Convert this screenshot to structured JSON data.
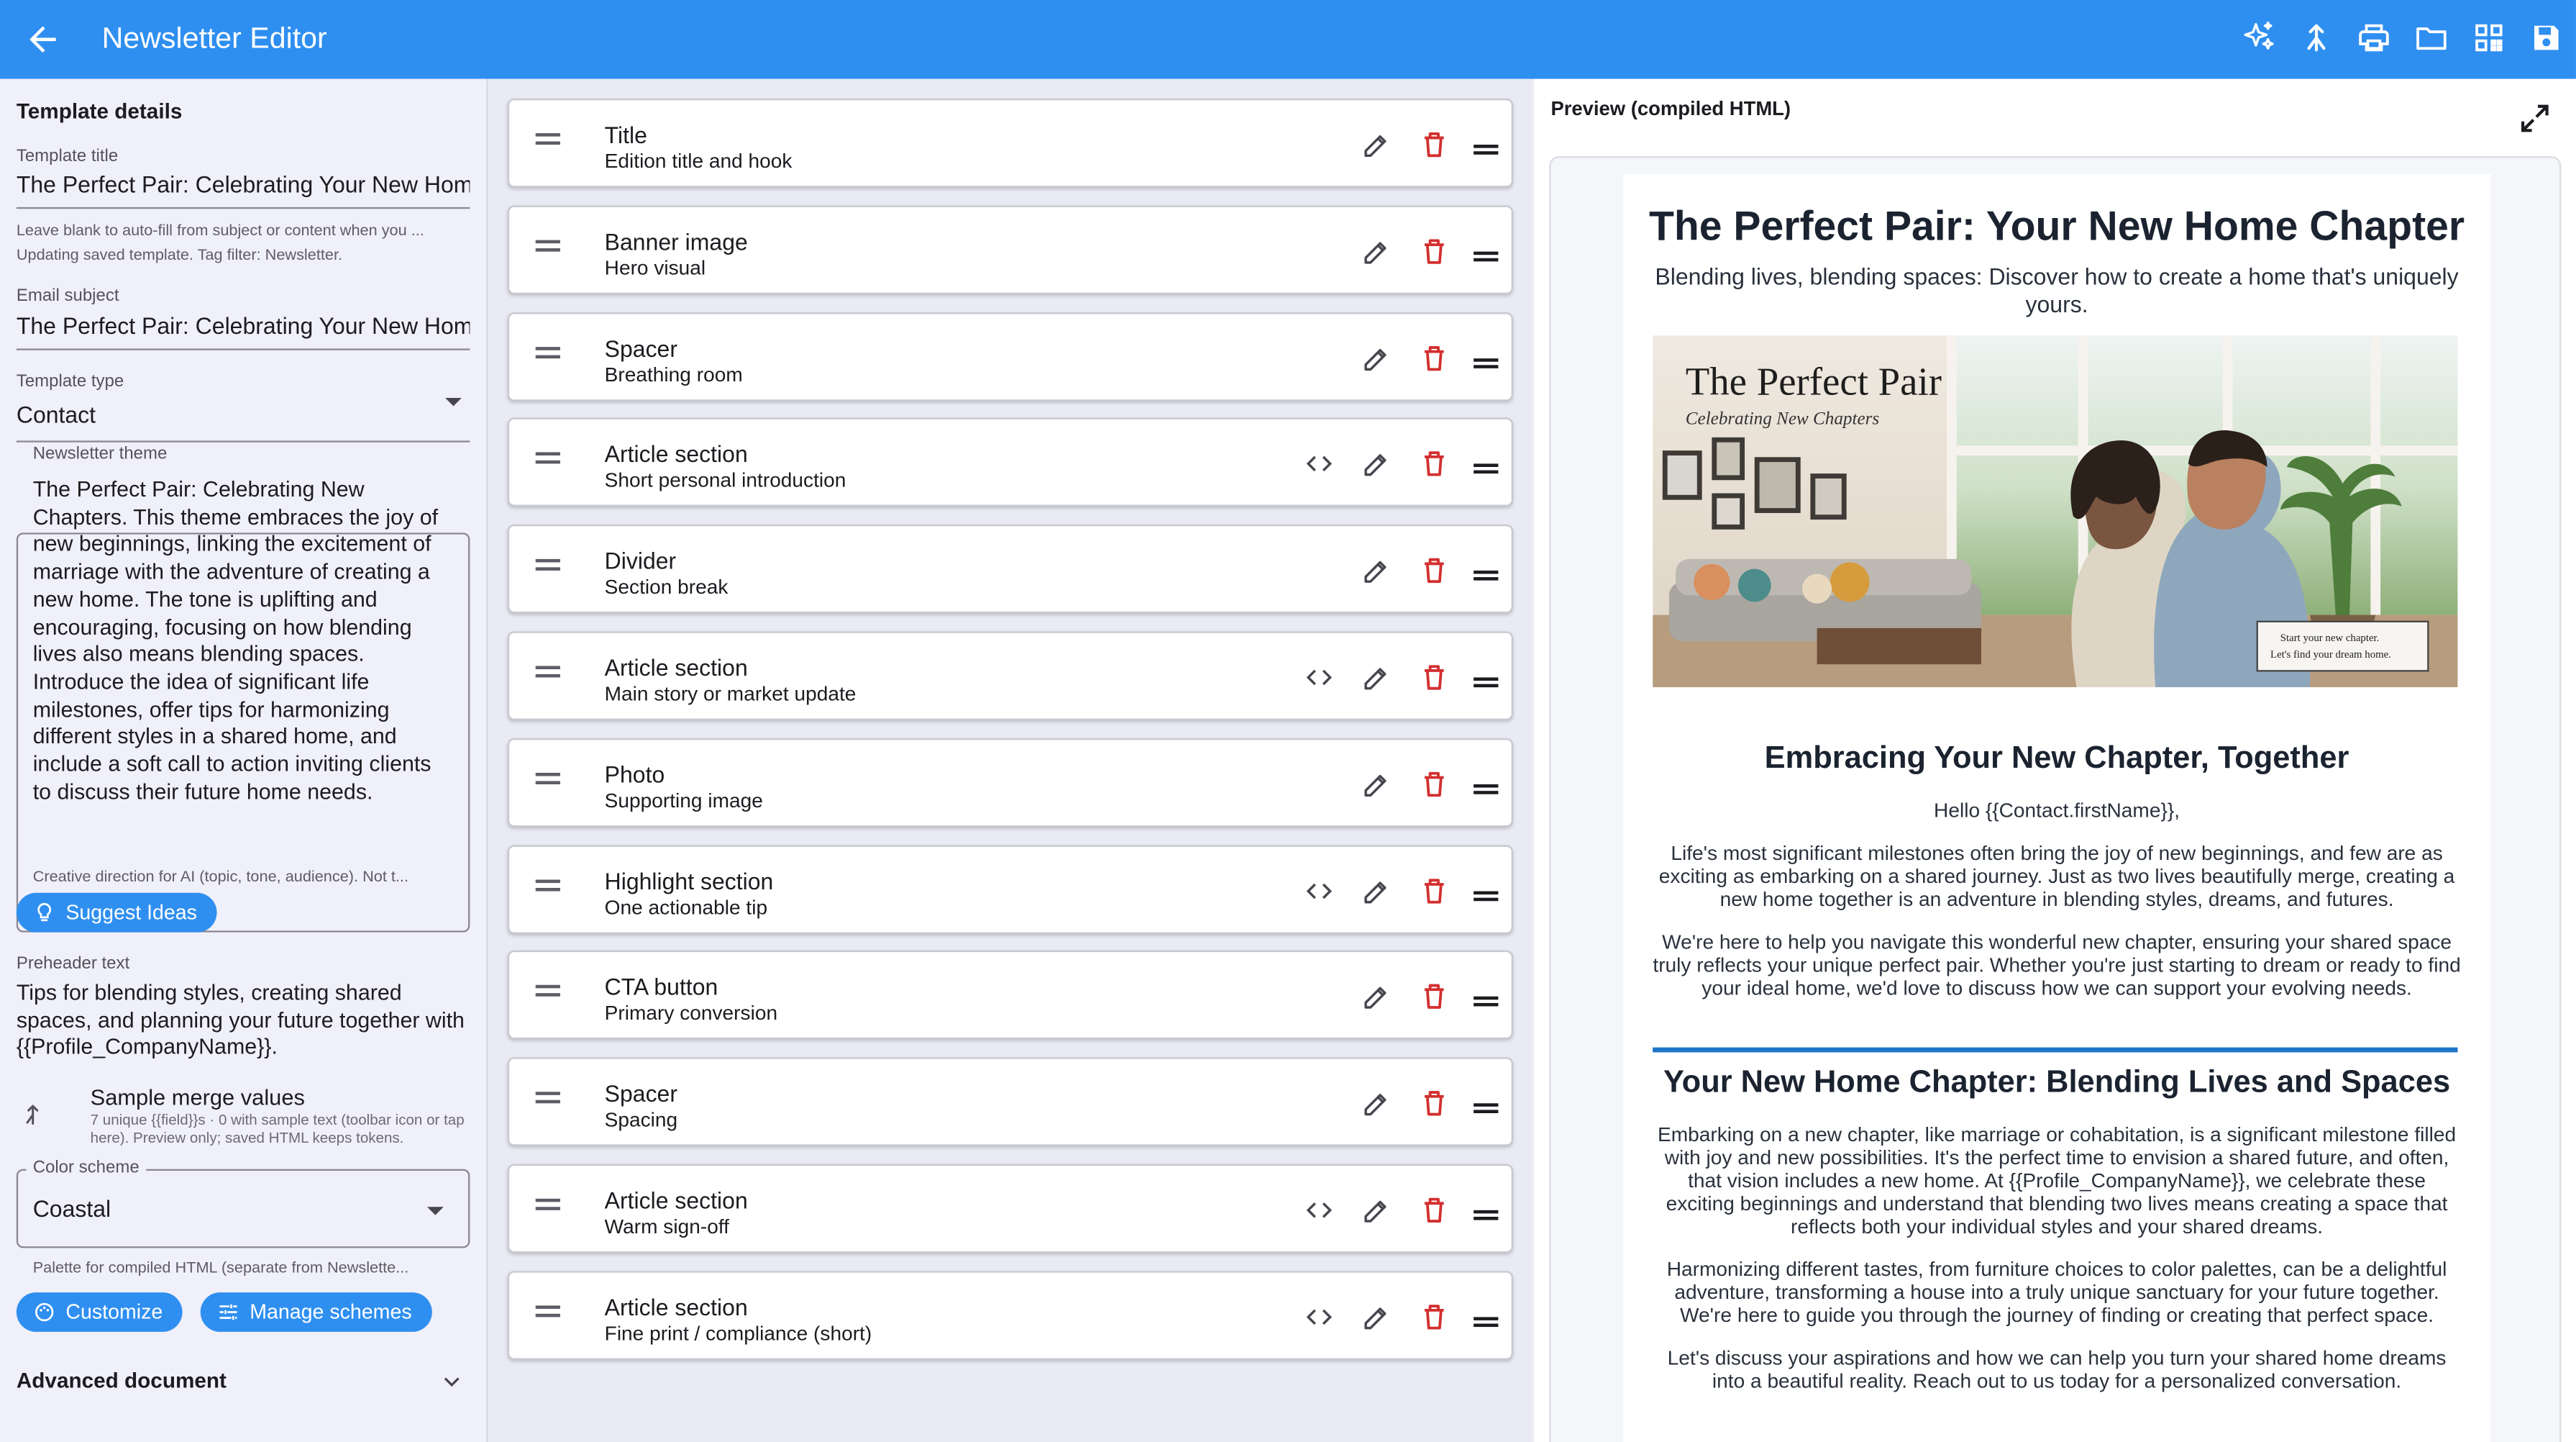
{
  "appbar": {
    "title": "Newsletter Editor",
    "icons": [
      "arrow-back-icon",
      "sparkle-icon",
      "merge-icon",
      "print-icon",
      "folder-icon",
      "dashboard-icon",
      "save-icon"
    ]
  },
  "left": {
    "section_title": "Template details",
    "template_title_label": "Template title",
    "template_title_value": "The Perfect Pair: Celebrating Your New Home",
    "template_title_help": "Leave blank to auto-fill from subject or content when you ...",
    "template_title_help2": "Updating saved template. Tag filter: Newsletter.",
    "email_subject_label": "Email subject",
    "email_subject_value": "The Perfect Pair: Celebrating Your New Home",
    "template_type_label": "Template type",
    "template_type_value": "Contact",
    "theme_label": "Newsletter theme",
    "theme_text": "The Perfect Pair: Celebrating New Chapters. This theme embraces the joy of new beginnings, linking the excitement of marriage with the adventure of creating a new home. The tone is uplifting and encouraging, focusing on how blending lives also means blending spaces. Introduce the idea of significant life milestones, offer tips for harmonizing different styles in a shared home, and include a soft call to action inviting clients to discuss their future home needs.",
    "theme_help": "Creative direction for AI (topic, tone, audience). Not t...",
    "suggest_button": "Suggest Ideas",
    "preheader_label": "Preheader text",
    "preheader_text": "Tips for blending styles, creating shared spaces, and planning your future together with {{Profile_CompanyName}}.",
    "merge_title": "Sample merge values",
    "merge_sub": "7 unique {{field}}s · 0 with sample text (toolbar icon or tap here). Preview only; saved HTML keeps tokens.",
    "color_scheme_label": "Color scheme",
    "color_scheme_value": "Coastal",
    "color_scheme_help": "Palette for compiled HTML (separate from Newslette...",
    "customize_button": "Customize",
    "manage_button": "Manage schemes",
    "advanced_label": "Advanced document"
  },
  "blocks": [
    {
      "title": "Title",
      "sub": "Edition title and hook",
      "code": false
    },
    {
      "title": "Banner image",
      "sub": "Hero visual",
      "code": false
    },
    {
      "title": "Spacer",
      "sub": "Breathing room",
      "code": false
    },
    {
      "title": "Article section",
      "sub": "Short personal introduction",
      "code": true
    },
    {
      "title": "Divider",
      "sub": "Section break",
      "code": false
    },
    {
      "title": "Article section",
      "sub": "Main story or market update",
      "code": true
    },
    {
      "title": "Photo",
      "sub": "Supporting image",
      "code": false
    },
    {
      "title": "Highlight section",
      "sub": "One actionable tip",
      "code": true
    },
    {
      "title": "CTA button",
      "sub": "Primary conversion",
      "code": false
    },
    {
      "title": "Spacer",
      "sub": "Spacing",
      "code": false
    },
    {
      "title": "Article section",
      "sub": "Warm sign-off",
      "code": true
    },
    {
      "title": "Article section",
      "sub": "Fine print / compliance (short)",
      "code": true
    }
  ],
  "preview": {
    "title": "Preview (compiled HTML)",
    "email_title": "The Perfect Pair: Your New Home Chapter",
    "email_subtitle": "Blending lives, blending spaces: Discover how to create a home that's uniquely yours.",
    "hero_title": "The Perfect Pair",
    "hero_subtitle": "Celebrating New Chapters",
    "hero_card_line1": "Start your new chapter.",
    "hero_card_line2": "Let's find your dream home.",
    "h2_1": "Embracing Your New Chapter, Together",
    "greeting": "Hello {{Contact.firstName}},",
    "p1": "Life's most significant milestones often bring the joy of new beginnings, and few are as exciting as embarking on a shared journey. Just as two lives beautifully merge, creating a new home together is an adventure in blending styles, dreams, and futures.",
    "p2": "We're here to help you navigate this wonderful new chapter, ensuring your shared space truly reflects your unique perfect pair. Whether you're just starting to dream or ready to find your ideal home, we'd love to discuss how we can support your evolving needs.",
    "h2_2": "Your New Home Chapter: Blending Lives and Spaces",
    "p3": "Embarking on a new chapter, like marriage or cohabitation, is a significant milestone filled with joy and new possibilities. It's the perfect time to envision a shared future, and often, that vision includes a new home. At {{Profile_CompanyName}}, we celebrate these exciting beginnings and understand that blending two lives means creating a space that reflects both your individual styles and your shared dreams.",
    "p4": "Harmonizing different tastes, from furniture choices to color palettes, can be a delightful adventure, transforming a house into a truly unique sanctuary for your future together. We're here to guide you through the journey of finding or creating that perfect space.",
    "p5": "Let's discuss your aspirations and how we can help you turn your shared home dreams into a beautiful reality. Reach out to us today for a personalized conversation."
  },
  "colors": {
    "primary": "#2f8ff0",
    "delete": "#d32f2f",
    "accent_rule": "#1f74c8"
  }
}
